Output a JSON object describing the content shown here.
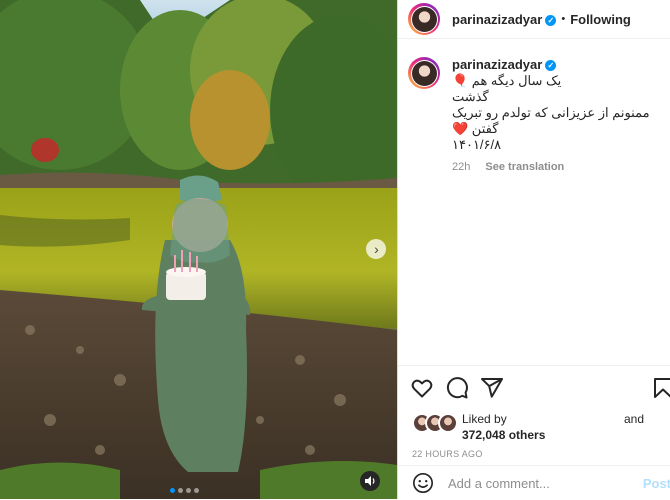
{
  "post": {
    "username": "parinazizadyar",
    "follow_label": "Following",
    "dot": "•",
    "caption_lines": [
      "یک سال دیگه هم 🎈",
      "گذشت",
      "ممنونم از عزیزانی که تولدم رو تبریک",
      "گفتن ❤️",
      "۱۴۰۱/۶/۸"
    ],
    "caption_age": "22h",
    "see_translation": "See translation",
    "liked_by": "Liked by",
    "and": "and",
    "likes_count": "372,048 others",
    "timestamp": "22 HOURS AGO",
    "comment_placeholder": "Add a comment...",
    "post_label": "Post",
    "carousel": {
      "slides": 4,
      "active": 1
    }
  },
  "icons": {
    "like": "heart-icon",
    "comment": "comment-icon",
    "share": "share-icon",
    "save": "bookmark-icon",
    "emoji": "emoji-icon",
    "next": "chevron-right-icon",
    "audio": "speaker-icon",
    "verified": "verified-badge-icon"
  },
  "colors": {
    "accent": "#0095f6",
    "post_button": "#b2dffc",
    "text": "#262626",
    "muted": "#8e8e8e"
  }
}
